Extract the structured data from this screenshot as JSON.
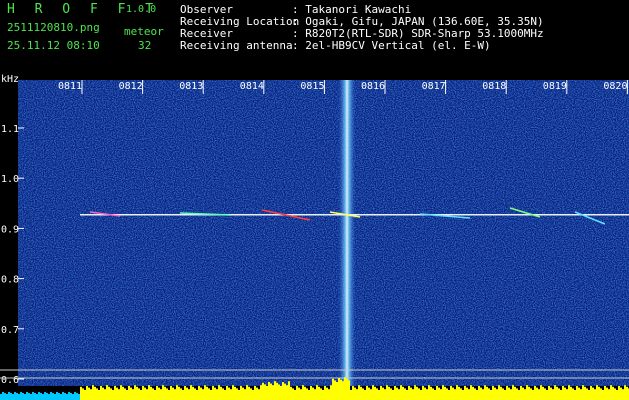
{
  "header": {
    "app_name": "H R O F F T",
    "version": "1.0.0",
    "filename": "2511120810.png",
    "datetime": "25.11.12 08:10",
    "meteor_label": "meteor",
    "meteor_count": "32",
    "fields": [
      {
        "label": "Observer",
        "value": ": Takanori Kawachi"
      },
      {
        "label": "Receiving Location",
        "value": ": Ogaki, Gifu, JAPAN (136.60E, 35.35N)"
      },
      {
        "label": "Receiver",
        "value": ": R820T2(RTL-SDR) SDR-Sharp 53.1000MHz"
      },
      {
        "label": "Receiving antenna",
        "value": ": 2el-HB9CV Vertical (el. E-W)"
      }
    ]
  },
  "spectrogram": {
    "unit_label": "kHz",
    "time_ticks": [
      "0811",
      "0812",
      "0813",
      "0814",
      "0815",
      "0816",
      "0817",
      "0818",
      "0819",
      "0820"
    ],
    "freq_ticks": [
      "1.1",
      "1.0",
      "0.9",
      "0.8",
      "0.7",
      "0.6"
    ],
    "colors": {
      "background": "#0a1a7a",
      "signal": "#e8f0ff",
      "noise_bar": "#ffff00",
      "cyan_bar": "#00c8ff"
    }
  }
}
